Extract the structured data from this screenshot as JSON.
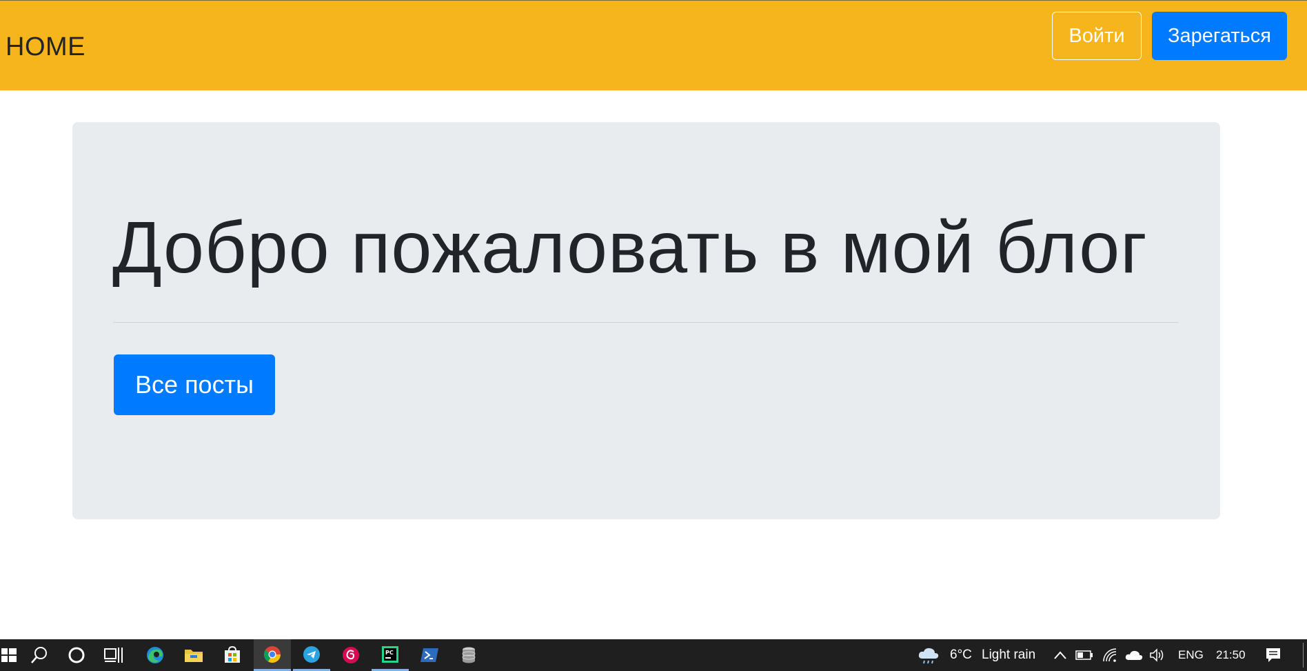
{
  "navbar": {
    "brand": "HOME",
    "login_label": "Войти",
    "register_label": "Зарегаться",
    "background_color": "#f6b51d"
  },
  "jumbotron": {
    "title": "Добро пожаловать в мой блог",
    "all_posts_label": "Все посты",
    "background_color": "#e8ecef"
  },
  "colors": {
    "primary": "#007bff",
    "text": "#212529"
  },
  "taskbar": {
    "apps": [
      {
        "icon": "windows-start-icon"
      },
      {
        "icon": "search-icon"
      },
      {
        "icon": "cortana-icon"
      },
      {
        "icon": "task-view-icon"
      },
      {
        "icon": "edge-icon"
      },
      {
        "icon": "file-explorer-icon"
      },
      {
        "icon": "store-icon"
      },
      {
        "icon": "chrome-icon"
      },
      {
        "icon": "telegram-icon"
      },
      {
        "icon": "debian-icon"
      },
      {
        "icon": "pycharm-icon"
      },
      {
        "icon": "powershell-icon"
      },
      {
        "icon": "database-icon"
      }
    ],
    "weather": {
      "temperature": "6°C",
      "condition": "Light rain",
      "icon": "cloud-rain-icon"
    },
    "language": "ENG",
    "time": "21:50"
  }
}
